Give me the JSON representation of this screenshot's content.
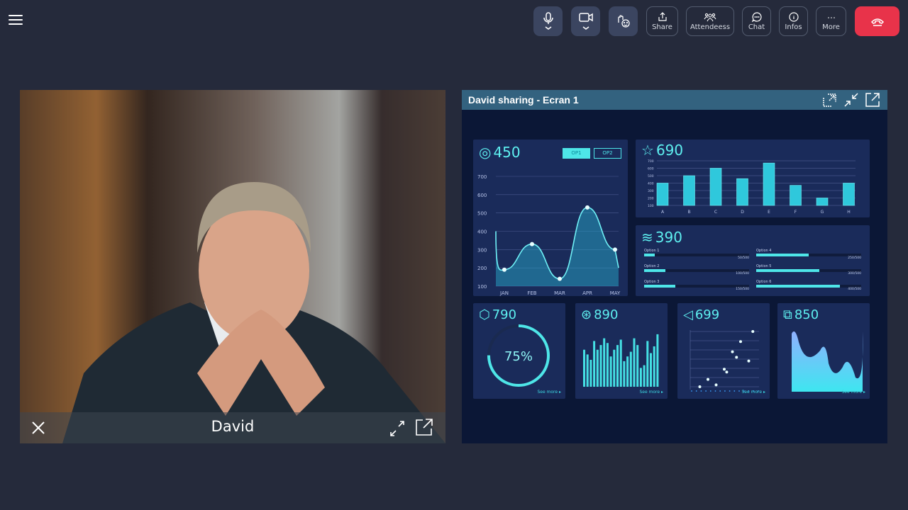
{
  "toolbar": {
    "share": "Share",
    "attendees": "Attendeess",
    "chat": "Chat",
    "infos": "Infos",
    "more": "More",
    "icons": [
      "menu-icon",
      "microphone-icon",
      "camera-icon",
      "raise-hand-icon",
      "share-icon",
      "attendees-icon",
      "chat-icon",
      "info-icon",
      "more-icon",
      "hang-up-icon"
    ],
    "end_color": "#e8334a"
  },
  "video": {
    "name": "David"
  },
  "share": {
    "title": "David sharing - Ecran 1",
    "dashboard": {
      "p1": {
        "value": "450",
        "op1": "OP1",
        "op2": "OP2",
        "yticks": [
          "700",
          "600",
          "500",
          "400",
          "300",
          "200",
          "100"
        ],
        "months": [
          "JAN",
          "FEB",
          "MAR",
          "APR",
          "MAY"
        ],
        "values": [
          190,
          330,
          140,
          530,
          300
        ]
      },
      "p2": {
        "value": "690",
        "yticks": [
          "700",
          "600",
          "500",
          "400",
          "300",
          "200",
          "100"
        ],
        "cats": [
          "A",
          "B",
          "C",
          "D",
          "E",
          "F",
          "G",
          "H"
        ],
        "values": [
          400,
          500,
          600,
          460,
          670,
          370,
          200,
          400
        ]
      },
      "p3": {
        "value": "390",
        "options": [
          {
            "label": "Option 1",
            "text": "50/500",
            "v": 50
          },
          {
            "label": "Option 2",
            "text": "100/500",
            "v": 100
          },
          {
            "label": "Option 3",
            "text": "150/500",
            "v": 150
          },
          {
            "label": "Option 4",
            "text": "250/500",
            "v": 250
          },
          {
            "label": "Option 5",
            "text": "300/500",
            "v": 300
          },
          {
            "label": "Option 6",
            "text": "400/500",
            "v": 400
          }
        ]
      },
      "p4": {
        "value": "790",
        "percent": "75%",
        "see": "See more ▸"
      },
      "p5": {
        "value": "890",
        "see": "See more ▸",
        "values": [
          55,
          48,
          40,
          68,
          55,
          62,
          72,
          65,
          45,
          55,
          62,
          70,
          38,
          45,
          52,
          72,
          62,
          28,
          32,
          68,
          50,
          60,
          78
        ]
      },
      "p6": {
        "value": "699",
        "see": "See more ▸",
        "points": [
          [
            1,
            100
          ],
          [
            2,
            180
          ],
          [
            3,
            120
          ],
          [
            4,
            290
          ],
          [
            4.3,
            260
          ],
          [
            5,
            480
          ],
          [
            5.5,
            420
          ],
          [
            6,
            590
          ],
          [
            7,
            380
          ],
          [
            7.5,
            700
          ]
        ]
      },
      "p7": {
        "value": "850",
        "see": "See more ▸"
      }
    },
    "colors": {
      "accent": "#5ef0f0",
      "header": "#33627f"
    }
  }
}
